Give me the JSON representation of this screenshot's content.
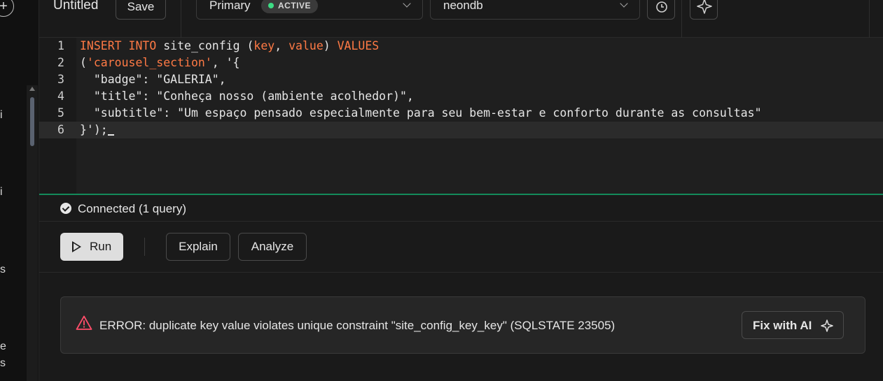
{
  "sidebar": {
    "fragments": [
      "i",
      "i",
      "s",
      "e",
      "s"
    ]
  },
  "header": {
    "title": "Untitled",
    "save_label": "Save",
    "branch": {
      "name": "Primary",
      "status": "ACTIVE"
    },
    "database": {
      "name": "neondb"
    }
  },
  "editor": {
    "lines": [
      {
        "number": "1"
      },
      {
        "number": "2"
      },
      {
        "number": "3"
      },
      {
        "number": "4"
      },
      {
        "number": "5"
      },
      {
        "number": "6"
      }
    ],
    "text": {
      "l1_kw1": "INSERT",
      "l1_kw2": "INTO",
      "l1_table": "site_config",
      "l1_col1": "key",
      "l1_col2": "value",
      "l1_kw3": "VALUES",
      "l2_str": "'carousel_section'",
      "l2_rest": ", '{",
      "l3": "  \"badge\": \"GALERIA\",",
      "l4": "  \"title\": \"Conheça nosso (ambiente acolhedor)\",",
      "l5": "  \"subtitle\": \"Um espaço pensado especialmente para seu bem-estar e conforto durante as consultas\"",
      "l6": "}');"
    }
  },
  "status": {
    "text": "Connected (1 query)"
  },
  "toolbar": {
    "run_label": "Run",
    "explain_label": "Explain",
    "analyze_label": "Analyze"
  },
  "error": {
    "message": "ERROR: duplicate key value violates unique constraint \"site_config_key_key\" (SQLSTATE 23505)",
    "fix_label": "Fix with AI"
  },
  "colors": {
    "keyword": "#ff7a45",
    "active_dot": "#3ddc84",
    "divider": "#138a5a",
    "error_icon": "#ff4d6a"
  }
}
